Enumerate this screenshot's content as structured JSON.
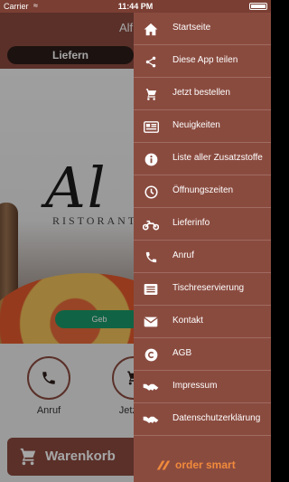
{
  "status_bar": {
    "carrier": "Carrier",
    "time": "11:44 PM"
  },
  "app_bar": {
    "title": "Alf"
  },
  "tabs": [
    {
      "label": "Liefern",
      "active": true
    }
  ],
  "hero": {
    "logo_script": "Al",
    "logo_sub": "RISTORANTE",
    "badge_fragment": "Geb"
  },
  "actions": [
    {
      "label": "Anruf",
      "icon": "phone-icon"
    },
    {
      "label": "Jetzt b",
      "icon": "cart-icon"
    }
  ],
  "cart": {
    "label": "Warenkorb",
    "icon": "cart-icon"
  },
  "drawer": {
    "items": [
      {
        "label": "Startseite",
        "icon": "home-icon"
      },
      {
        "label": "Diese App teilen",
        "icon": "share-icon"
      },
      {
        "label": "Jetzt bestellen",
        "icon": "cart-icon"
      },
      {
        "label": "Neuigkeiten",
        "icon": "newspaper-icon"
      },
      {
        "label": "Liste aller Zusatzstoffe",
        "icon": "info-icon"
      },
      {
        "label": "Öffnungszeiten",
        "icon": "clock-icon"
      },
      {
        "label": "Lieferinfo",
        "icon": "motorcycle-icon"
      },
      {
        "label": "Anruf",
        "icon": "phone-icon"
      },
      {
        "label": "Tischreservierung",
        "icon": "list-icon"
      },
      {
        "label": "Kontakt",
        "icon": "envelope-icon"
      },
      {
        "label": "AGB",
        "icon": "copyright-icon"
      },
      {
        "label": "Impressum",
        "icon": "handshake-icon"
      },
      {
        "label": "Datenschutzerklärung",
        "icon": "handshake-icon"
      }
    ],
    "brand": "order smart"
  },
  "colors": {
    "primary": "#8a4b3f",
    "dark": "#2b1d1a",
    "accent_green": "#1a9a6b",
    "brand_orange": "#f08a3c"
  }
}
